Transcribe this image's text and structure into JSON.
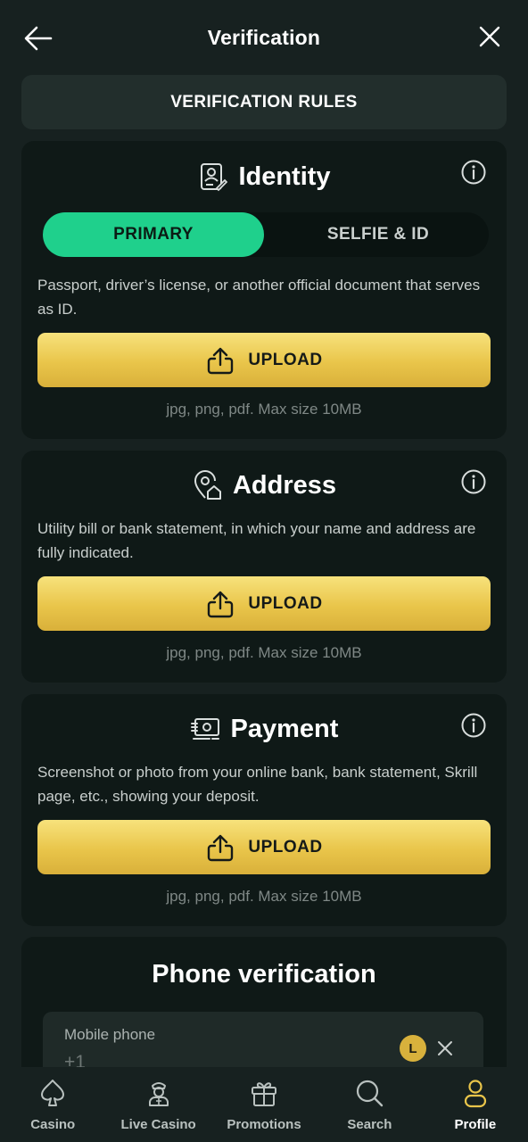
{
  "header": {
    "title": "Verification"
  },
  "rules_button": "VERIFICATION RULES",
  "identity": {
    "title": "Identity",
    "tabs": [
      "PRIMARY",
      "SELFIE & ID"
    ],
    "active_tab": "PRIMARY",
    "description": "Passport, driver’s license, or another official document that serves as ID.",
    "upload_label": "UPLOAD",
    "hint": "jpg, png, pdf. Max size 10MB"
  },
  "address": {
    "title": "Address",
    "description": "Utility bill or bank statement, in which your name and address are fully indicated.",
    "upload_label": "UPLOAD",
    "hint": "jpg, png, pdf. Max size 10MB"
  },
  "payment": {
    "title": "Payment",
    "description": "Screenshot or photo from your online bank, bank statement, Skrill page, etc., showing your deposit.",
    "upload_label": "UPLOAD",
    "hint": "jpg, png, pdf. Max size 10MB"
  },
  "phone": {
    "title": "Phone verification",
    "field_label": "Mobile phone",
    "field_value": "+1",
    "badge": "L"
  },
  "nav": {
    "items": [
      {
        "label": "Casino",
        "icon": "spade-icon"
      },
      {
        "label": "Live Casino",
        "icon": "dealer-icon"
      },
      {
        "label": "Promotions",
        "icon": "gift-icon"
      },
      {
        "label": "Search",
        "icon": "search-icon"
      },
      {
        "label": "Profile",
        "icon": "profile-icon"
      }
    ],
    "active": "Profile"
  },
  "colors": {
    "background": "#172120",
    "card": "#0f1917",
    "accent_green": "#1fd08c",
    "upload_gold": "#e9c54a",
    "active_nav": "#e9c54a"
  }
}
